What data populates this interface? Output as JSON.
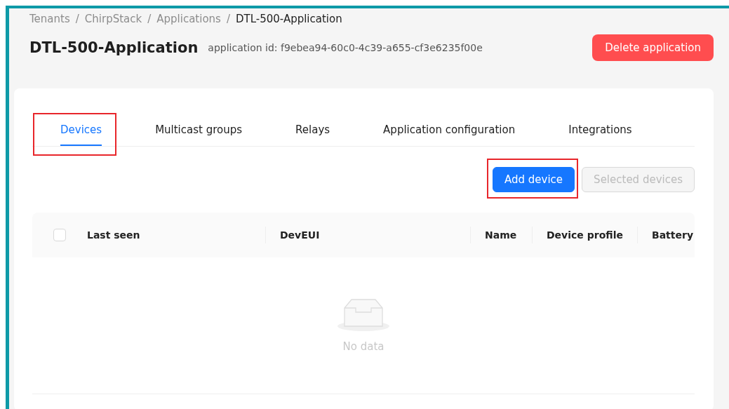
{
  "breadcrumb": [
    {
      "label": "Tenants",
      "current": false
    },
    {
      "label": "ChirpStack",
      "current": false
    },
    {
      "label": "Applications",
      "current": false
    },
    {
      "label": "DTL-500-Application",
      "current": true
    }
  ],
  "breadcrumb_separator": "/",
  "title": "DTL-500-Application",
  "subtitle": "application id: f9ebea94-60c0-4c39-a655-cf3e6235f00e",
  "delete_button": "Delete application",
  "tabs": [
    {
      "label": "Devices",
      "selected": true,
      "highlighted": true
    },
    {
      "label": "Multicast groups",
      "selected": false,
      "highlighted": false
    },
    {
      "label": "Relays",
      "selected": false,
      "highlighted": false
    },
    {
      "label": "Application configuration",
      "selected": false,
      "highlighted": false
    },
    {
      "label": "Integrations",
      "selected": false,
      "highlighted": false
    }
  ],
  "actions": [
    {
      "label": "Add device",
      "kind": "primary",
      "disabled": false,
      "highlighted": true
    },
    {
      "label": "Selected devices",
      "kind": "default",
      "disabled": true,
      "highlighted": false
    }
  ],
  "table": {
    "select_all_checked": false,
    "columns": [
      "Last seen",
      "DevEUI",
      "Name",
      "Device profile",
      "Battery"
    ],
    "empty_text": "No data"
  }
}
